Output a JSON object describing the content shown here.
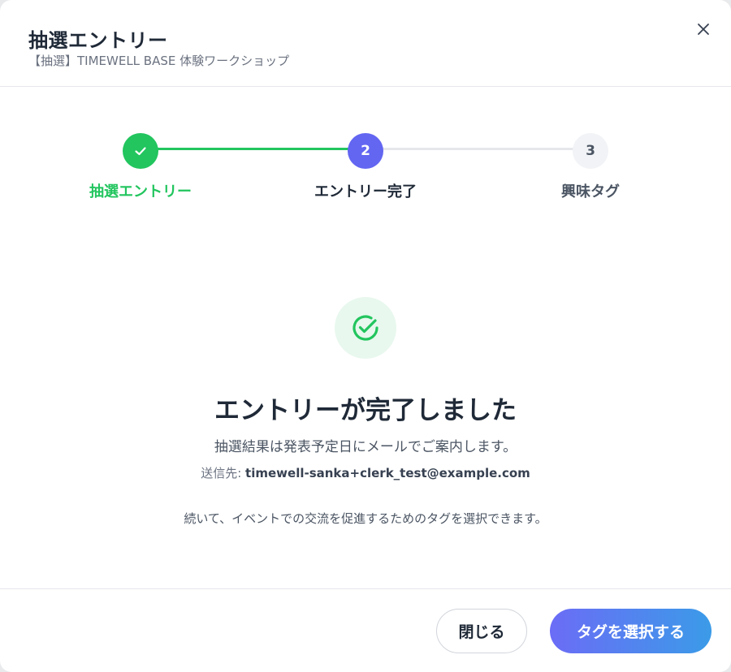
{
  "dialog": {
    "title": "抽選エントリー",
    "subtitle": "【抽選】TIMEWELL BASE 体験ワークショップ"
  },
  "stepper": {
    "steps": [
      {
        "label": "抽選エントリー",
        "number": "1",
        "status": "done"
      },
      {
        "label": "エントリー完了",
        "number": "2",
        "status": "current"
      },
      {
        "label": "興味タグ",
        "number": "3",
        "status": "todo"
      }
    ]
  },
  "success": {
    "heading": "エントリーが完了しました",
    "description": "抽選結果は発表予定日にメールでご案内します。",
    "recipient_label": "送信先:",
    "recipient_email": "timewell-sanka+clerk_test@example.com",
    "note": "続いて、イベントでの交流を促進するためのタグを選択できます。"
  },
  "footer": {
    "close_label": "閉じる",
    "primary_label": "タグを選択する"
  },
  "colors": {
    "success": "#22c55e",
    "accent": "#6366f1",
    "gradient_start": "#6b6cf6",
    "gradient_end": "#3b9be8"
  },
  "icons": [
    "close-icon",
    "check-icon",
    "check-circle-icon"
  ]
}
